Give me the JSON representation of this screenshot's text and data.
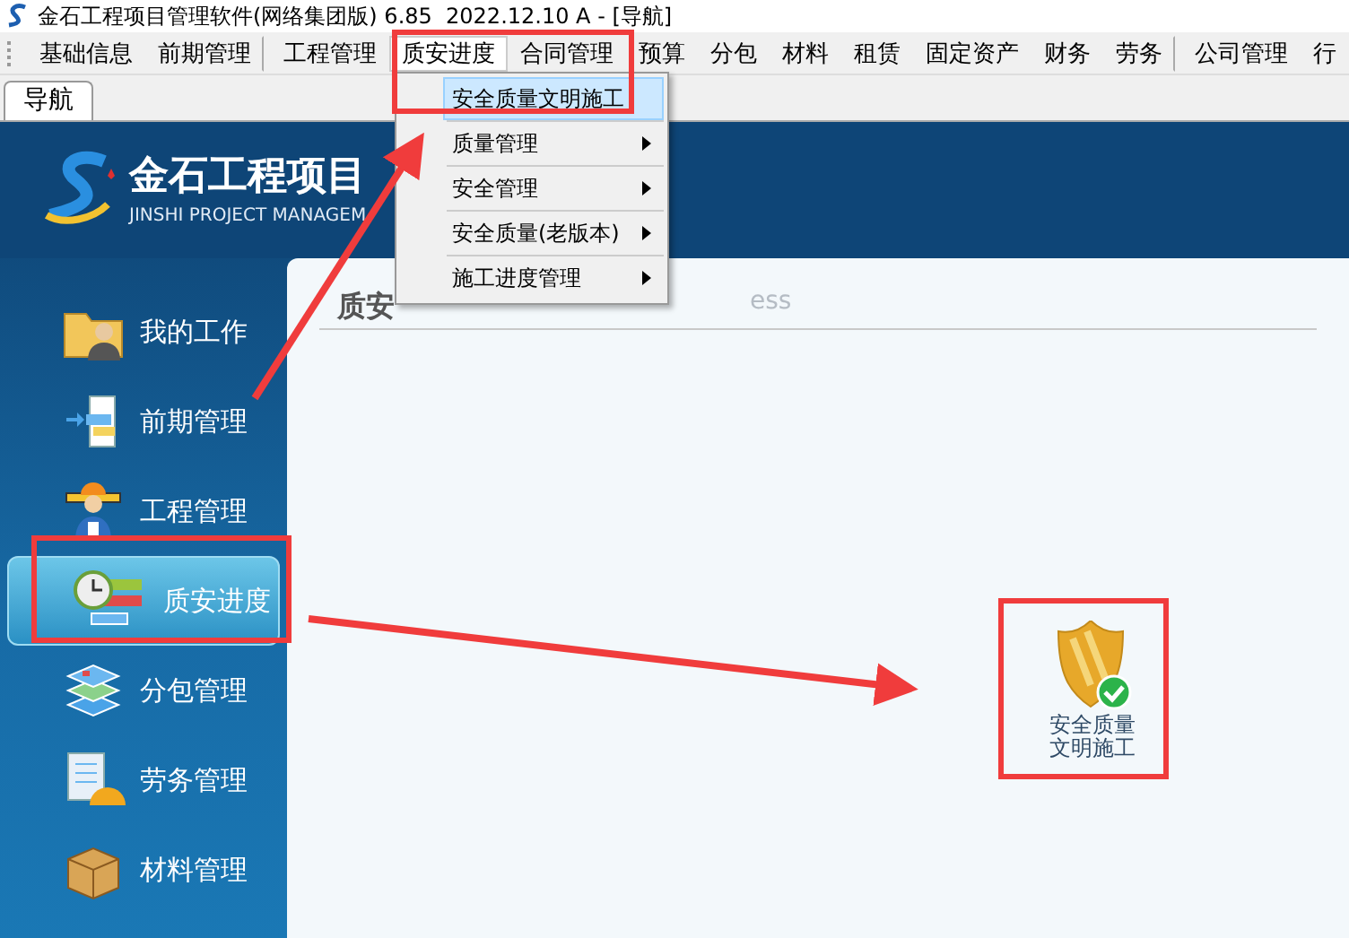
{
  "window": {
    "title": "金石工程项目管理软件(网络集团版) 6.85  2022.12.10 A - [导航]"
  },
  "menu_bar": {
    "items": [
      {
        "label": "基础信息",
        "selected": false,
        "separator_after": false
      },
      {
        "label": "前期管理",
        "selected": false,
        "separator_after": true
      },
      {
        "label": "工程管理",
        "selected": false,
        "separator_after": false
      },
      {
        "label": "质安进度",
        "selected": true,
        "separator_after": false
      },
      {
        "label": "合同管理",
        "selected": false,
        "separator_after": false
      },
      {
        "label": "预算",
        "selected": false,
        "separator_after": false
      },
      {
        "label": "分包",
        "selected": false,
        "separator_after": false
      },
      {
        "label": "材料",
        "selected": false,
        "separator_after": false
      },
      {
        "label": "租赁",
        "selected": false,
        "separator_after": false
      },
      {
        "label": "固定资产",
        "selected": false,
        "separator_after": false
      },
      {
        "label": "财务",
        "selected": false,
        "separator_after": false
      },
      {
        "label": "劳务",
        "selected": false,
        "separator_after": true
      },
      {
        "label": "公司管理",
        "selected": false,
        "separator_after": false
      },
      {
        "label": "行",
        "selected": false,
        "separator_after": false
      }
    ]
  },
  "tabs": [
    {
      "label": "导航",
      "selected": true
    }
  ],
  "dropdown": {
    "items": [
      {
        "label": "安全质量文明施工",
        "selected": true,
        "submenu": false
      },
      {
        "label": "质量管理",
        "selected": false,
        "submenu": true
      },
      {
        "label": "安全管理",
        "selected": false,
        "submenu": true
      },
      {
        "label": "安全质量(老版本)",
        "selected": false,
        "submenu": true
      },
      {
        "label": "施工进度管理",
        "selected": false,
        "submenu": true
      }
    ]
  },
  "banner": {
    "title": "金石工程项目",
    "subtitle": "JINSHI PROJECT MANAGEM"
  },
  "sidebar": {
    "items": [
      {
        "label": "我的工作",
        "selected": false,
        "kind": "folder"
      },
      {
        "label": "前期管理",
        "selected": false,
        "kind": "blocks"
      },
      {
        "label": "工程管理",
        "selected": false,
        "kind": "worker"
      },
      {
        "label": "质安进度",
        "selected": true,
        "kind": "clock"
      },
      {
        "label": "分包管理",
        "selected": false,
        "kind": "layers"
      },
      {
        "label": "劳务管理",
        "selected": false,
        "kind": "document"
      },
      {
        "label": "材料管理",
        "selected": false,
        "kind": "box"
      }
    ]
  },
  "panel": {
    "title": "质安",
    "subtitle": "ess",
    "tiles": [
      {
        "label": "安全质量文明施工"
      }
    ]
  }
}
